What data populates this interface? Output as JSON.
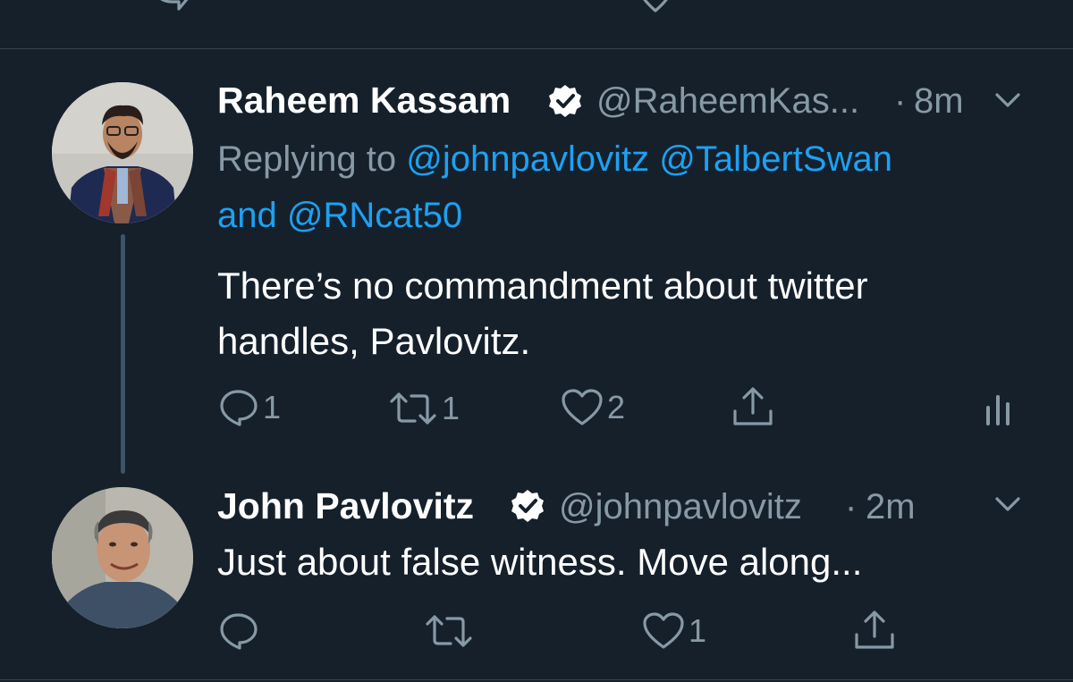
{
  "tweet1": {
    "name": "Raheem Kassam",
    "handle": "@RaheemKas...",
    "sep": "·",
    "time": "8m",
    "replying_prefix": "Replying to",
    "mention1": "@johnpavlovitz",
    "mention2": "@TalbertSwan",
    "and_text": "and",
    "mention3": "@RNcat50",
    "text_line1": "There’s no commandment about twitter",
    "text_line2": "handles, Pavlovitz.",
    "reply_count": "1",
    "retweet_count": "1",
    "like_count": "2"
  },
  "tweet2": {
    "name": "John Pavlovitz",
    "handle": "@johnpavlovitz",
    "sep": "·",
    "time": "2m",
    "text": "Just about false witness. Move along...",
    "like_count": "1"
  },
  "icons": {
    "reply": "reply-icon",
    "retweet": "retweet-icon",
    "like": "heart-icon",
    "share": "share-icon",
    "analytics": "analytics-icon",
    "verified": "verified-badge-icon",
    "menu": "chevron-down-icon"
  },
  "colors": {
    "background": "#15202b",
    "text": "#ffffff",
    "secondary": "#8899a6",
    "link": "#1da1f2",
    "divider": "#38444d"
  }
}
